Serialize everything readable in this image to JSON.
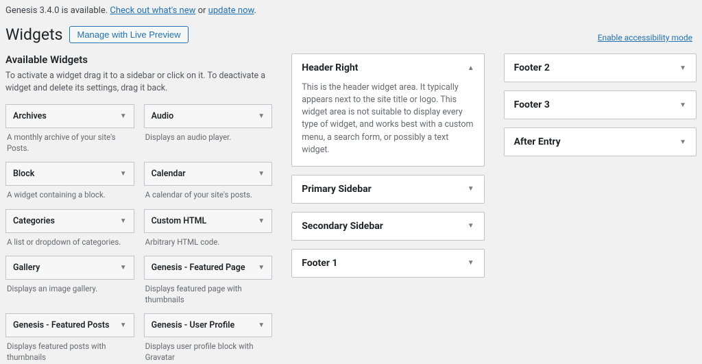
{
  "notice": {
    "pre": "Genesis 3.4.0 is available. ",
    "link1": "Check out what's new",
    "mid": " or ",
    "link2": "update now",
    "post": "."
  },
  "accessibility_link": "Enable accessibility mode",
  "page_title": "Widgets",
  "manage_button": "Manage with Live Preview",
  "available": {
    "heading": "Available Widgets",
    "description": "To activate a widget drag it to a sidebar or click on it. To deactivate a widget and delete its settings, drag it back.",
    "widgets": [
      {
        "title": "Archives",
        "desc": "A monthly archive of your site's Posts."
      },
      {
        "title": "Audio",
        "desc": "Displays an audio player."
      },
      {
        "title": "Block",
        "desc": "A widget containing a block."
      },
      {
        "title": "Calendar",
        "desc": "A calendar of your site's posts."
      },
      {
        "title": "Categories",
        "desc": "A list or dropdown of categories."
      },
      {
        "title": "Custom HTML",
        "desc": "Arbitrary HTML code."
      },
      {
        "title": "Gallery",
        "desc": "Displays an image gallery."
      },
      {
        "title": "Genesis - Featured Page",
        "desc": "Displays featured page with thumbnails"
      },
      {
        "title": "Genesis - Featured Posts",
        "desc": "Displays featured posts with thumbnails"
      },
      {
        "title": "Genesis - User Profile",
        "desc": "Displays user profile block with Gravatar"
      }
    ]
  },
  "areas_mid": [
    {
      "title": "Header Right",
      "expanded": true,
      "desc": "This is the header widget area. It typically appears next to the site title or logo. This widget area is not suitable to display every type of widget, and works best with a custom menu, a search form, or possibly a text widget."
    },
    {
      "title": "Primary Sidebar",
      "expanded": false
    },
    {
      "title": "Secondary Sidebar",
      "expanded": false
    },
    {
      "title": "Footer 1",
      "expanded": false
    }
  ],
  "areas_right": [
    {
      "title": "Footer 2",
      "expanded": false
    },
    {
      "title": "Footer 3",
      "expanded": false
    },
    {
      "title": "After Entry",
      "expanded": false
    }
  ]
}
